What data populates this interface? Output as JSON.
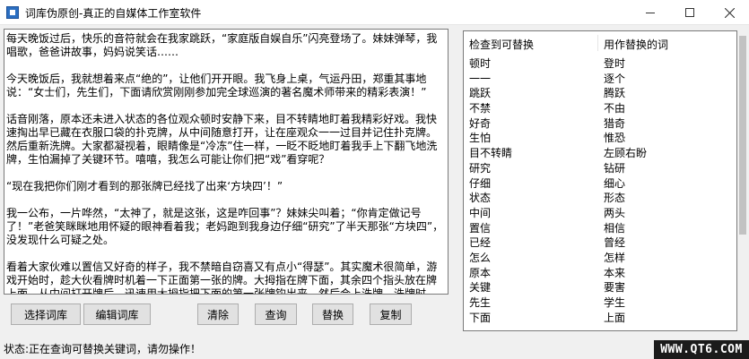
{
  "window": {
    "title": "词库伪原创-真正的自媒体工作室软件"
  },
  "editor": {
    "paragraphs": [
      "每天晚饭过后，快乐的音符就会在我家跳跃，“家庭版自娱自乐”闪亮登场了。妹妹弹琴，我唱歌，爸爸讲故事，妈妈说笑话……",
      "",
      "今天晚饭后，我就想着来点“绝的”，让他们开开眼。我飞身上桌，气运丹田，郑重其事地说：“女士们，先生们，下面请欣赏刚刚参加完全球巡演的著名魔术师带来的精彩表演！”",
      "",
      "话音刚落，原本还未进入状态的各位观众顿时安静下来，目不转睛地盯着我精彩好戏。我快速掏出早已藏在衣服口袋的扑克牌，从中间随意打开，让在座观众一一过目并记住扑克牌。然后重新洗牌。大家都凝视着，眼睛像是“冷冻”住一样，一眨不眨地盯着我手上下翻飞地洗牌，生怕漏掉了关键环节。嘻嘻，我怎么可能让你们把“戏”看穿呢？",
      "",
      "“现在我把你们刚才看到的那张牌已经找了出来‘方块四’！”",
      "",
      "我一公布，一片哗然，“太神了，就是这张，这是咋回事”？妹妹尖叫着；“你肯定做记号了！”老爸笑眯眯地用怀疑的眼神看着我；老妈跑到我身边仔细“研究”了半天那张“方块四”，没发现什么可疑之处。",
      "",
      "看着大家伙难以置信又好奇的样子，我不禁暗自窃喜又有点小“得瑟”。其实魔术很简单，游戏开始时，趁大伙看牌时机着一下正面第一张的牌。大拇指在牌下面，其余四个指头放在牌上面。从中间打开牌后，迅速用大拇指把下面的第一张牌钩出来，然后合上洗牌。洗牌时，中间牌不打乱，第一张牌后面的那一张就是了。"
    ]
  },
  "buttons": {
    "select_lib": "选择词库",
    "edit_lib": "编辑词库",
    "clear": "清除",
    "query": "查询",
    "replace": "替换",
    "copy": "复制"
  },
  "word_list": {
    "col_found": "检查到可替换",
    "col_replace": "用作替换的词",
    "rows": [
      {
        "found": "顿时",
        "replace": "登时"
      },
      {
        "found": "一一",
        "replace": "逐个"
      },
      {
        "found": "跳跃",
        "replace": "腾跃"
      },
      {
        "found": "不禁",
        "replace": "不由"
      },
      {
        "found": "好奇",
        "replace": "猎奇"
      },
      {
        "found": "生怕",
        "replace": "惟恐"
      },
      {
        "found": "目不转睛",
        "replace": "左顾右盼"
      },
      {
        "found": "研究",
        "replace": "钻研"
      },
      {
        "found": "仔细",
        "replace": "细心"
      },
      {
        "found": "状态",
        "replace": "形态"
      },
      {
        "found": "中间",
        "replace": "两头"
      },
      {
        "found": "置信",
        "replace": "相信"
      },
      {
        "found": "已经",
        "replace": "曾经"
      },
      {
        "found": "怎么",
        "replace": "怎样"
      },
      {
        "found": "原本",
        "replace": "本来"
      },
      {
        "found": "关键",
        "replace": "要害"
      },
      {
        "found": "先生",
        "replace": "学生"
      },
      {
        "found": "下面",
        "replace": "上面"
      }
    ]
  },
  "status": {
    "text": "状态:正在查询可替换关键词，请勿操作！"
  },
  "watermark": {
    "text": "WWW.QT6.COM"
  }
}
